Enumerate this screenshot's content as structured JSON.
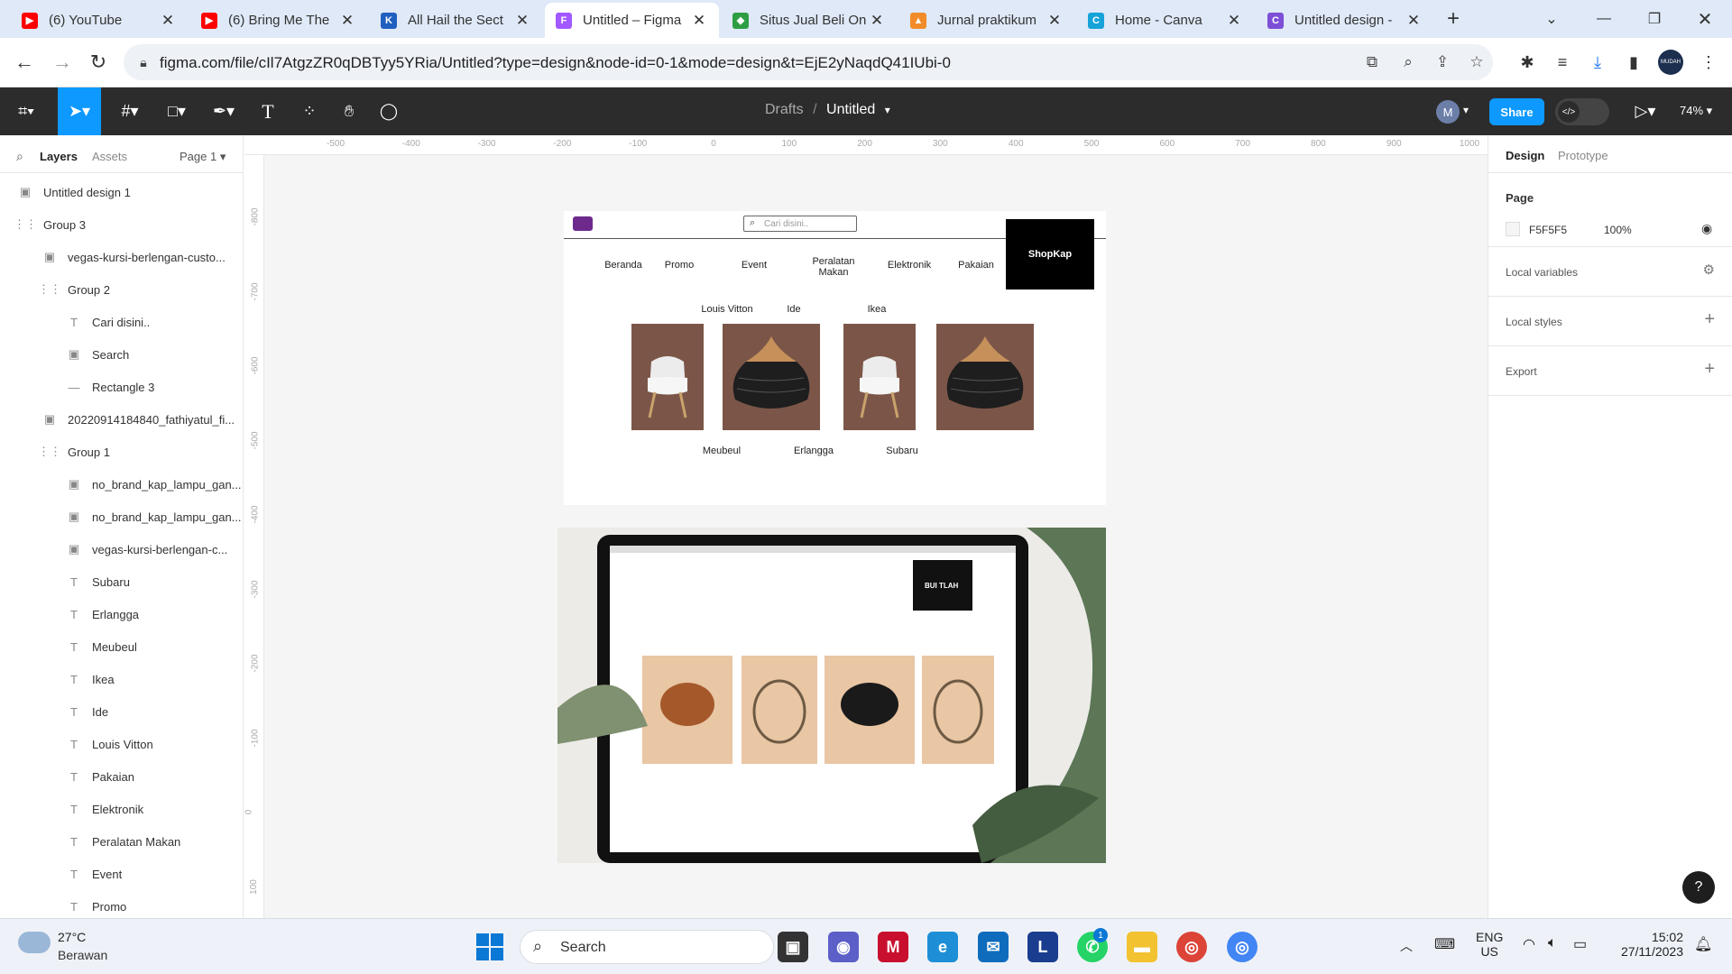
{
  "browser": {
    "tabs": [
      {
        "title": "(6) YouTube",
        "color": "#ff0000",
        "glyph": "▶"
      },
      {
        "title": "(6) Bring Me The",
        "color": "#ff0000",
        "glyph": "▶"
      },
      {
        "title": "All Hail the Sect",
        "color": "#1f5fbf",
        "glyph": "K"
      },
      {
        "title": "Untitled – Figma",
        "color": "#a259ff",
        "glyph": "F"
      },
      {
        "title": "Situs Jual Beli On",
        "color": "#2e9e44",
        "glyph": "◆"
      },
      {
        "title": "Jurnal praktikum",
        "color": "#f28c28",
        "glyph": "▲"
      },
      {
        "title": "Home - Canva",
        "color": "#16a3d8",
        "glyph": "C"
      },
      {
        "title": "Untitled design -",
        "color": "#7d4fd6",
        "glyph": "C"
      }
    ],
    "url": "figma.com/file/cIl7AtgzZR0qDBTyy5YRia/Untitled?type=design&node-id=0-1&mode=design&t=EjE2yNaqdQ41IUbi-0",
    "profile_label": "MUDAH"
  },
  "figma": {
    "breadcrumb_drafts": "Drafts",
    "breadcrumb_sep": "/",
    "file_name": "Untitled",
    "avatar_letter": "M",
    "share_label": "Share",
    "zoom": "74%"
  },
  "left_panel": {
    "tab_layers": "Layers",
    "tab_assets": "Assets",
    "page_select": "Page 1",
    "layers": [
      {
        "name": "Untitled design 1",
        "icon": "image-icon",
        "glyph": "▣",
        "indent": 0
      },
      {
        "name": "Group 3",
        "icon": "group-icon",
        "glyph": "⋮⋮",
        "indent": 0
      },
      {
        "name": "vegas-kursi-berlengan-custo...",
        "icon": "image-icon",
        "glyph": "▣",
        "indent": 1
      },
      {
        "name": "Group 2",
        "icon": "group-icon",
        "glyph": "⋮⋮",
        "indent": 1
      },
      {
        "name": "Cari disini..",
        "icon": "text-icon",
        "glyph": "T",
        "indent": 2
      },
      {
        "name": "Search",
        "icon": "image-icon",
        "glyph": "▣",
        "indent": 2
      },
      {
        "name": "Rectangle 3",
        "icon": "line-icon",
        "glyph": "—",
        "indent": 2
      },
      {
        "name": "20220914184840_fathiyatul_fi...",
        "icon": "image-icon",
        "glyph": "▣",
        "indent": 1
      },
      {
        "name": "Group 1",
        "icon": "group-icon",
        "glyph": "⋮⋮",
        "indent": 1
      },
      {
        "name": "no_brand_kap_lampu_gan...",
        "icon": "image-icon",
        "glyph": "▣",
        "indent": 2
      },
      {
        "name": "no_brand_kap_lampu_gan...",
        "icon": "image-icon",
        "glyph": "▣",
        "indent": 2
      },
      {
        "name": "vegas-kursi-berlengan-c...",
        "icon": "image-icon",
        "glyph": "▣",
        "indent": 2
      },
      {
        "name": "Subaru",
        "icon": "text-icon",
        "glyph": "T",
        "indent": 2
      },
      {
        "name": "Erlangga",
        "icon": "text-icon",
        "glyph": "T",
        "indent": 2
      },
      {
        "name": "Meubeul",
        "icon": "text-icon",
        "glyph": "T",
        "indent": 2
      },
      {
        "name": "Ikea",
        "icon": "text-icon",
        "glyph": "T",
        "indent": 2
      },
      {
        "name": "Ide",
        "icon": "text-icon",
        "glyph": "T",
        "indent": 2
      },
      {
        "name": "Louis Vitton",
        "icon": "text-icon",
        "glyph": "T",
        "indent": 2
      },
      {
        "name": "Pakaian",
        "icon": "text-icon",
        "glyph": "T",
        "indent": 2
      },
      {
        "name": "Elektronik",
        "icon": "text-icon",
        "glyph": "T",
        "indent": 2
      },
      {
        "name": "Peralatan Makan",
        "icon": "text-icon",
        "glyph": "T",
        "indent": 2
      },
      {
        "name": "Event",
        "icon": "text-icon",
        "glyph": "T",
        "indent": 2
      },
      {
        "name": "Promo",
        "icon": "text-icon",
        "glyph": "T",
        "indent": 2
      }
    ]
  },
  "rulers": {
    "top": [
      "-500",
      "-400",
      "-300",
      "-200",
      "-100",
      "0",
      "100",
      "200",
      "300",
      "400",
      "500",
      "600",
      "700",
      "800",
      "900",
      "1000"
    ],
    "left": [
      "-800",
      "-700",
      "-600",
      "-500",
      "-400",
      "-300",
      "-200",
      "-100",
      "0",
      "100"
    ]
  },
  "design": {
    "search_placeholder": "Cari disini..",
    "nav": [
      "Beranda",
      "Promo",
      "Event",
      "Peralatan Makan",
      "Elektronik",
      "Pakaian"
    ],
    "brand_box": "ShopKap",
    "brand_top": [
      "Louis Vitton",
      "Ide",
      "Ikea"
    ],
    "brand_bottom": [
      "Meubeul",
      "Erlangga",
      "Subaru"
    ],
    "mock_brand": "BUI TLAH"
  },
  "right_panel": {
    "tab_design": "Design",
    "tab_prototype": "Prototype",
    "page_label": "Page",
    "page_color": "F5F5F5",
    "page_opacity": "100%",
    "local_variables": "Local variables",
    "local_styles": "Local styles",
    "export": "Export"
  },
  "taskbar": {
    "temp": "27°C",
    "weather": "Berawan",
    "search_label": "Search",
    "lang1": "ENG",
    "lang2": "US",
    "time": "15:02",
    "date": "27/11/2023",
    "whatsapp_badge": "1"
  }
}
